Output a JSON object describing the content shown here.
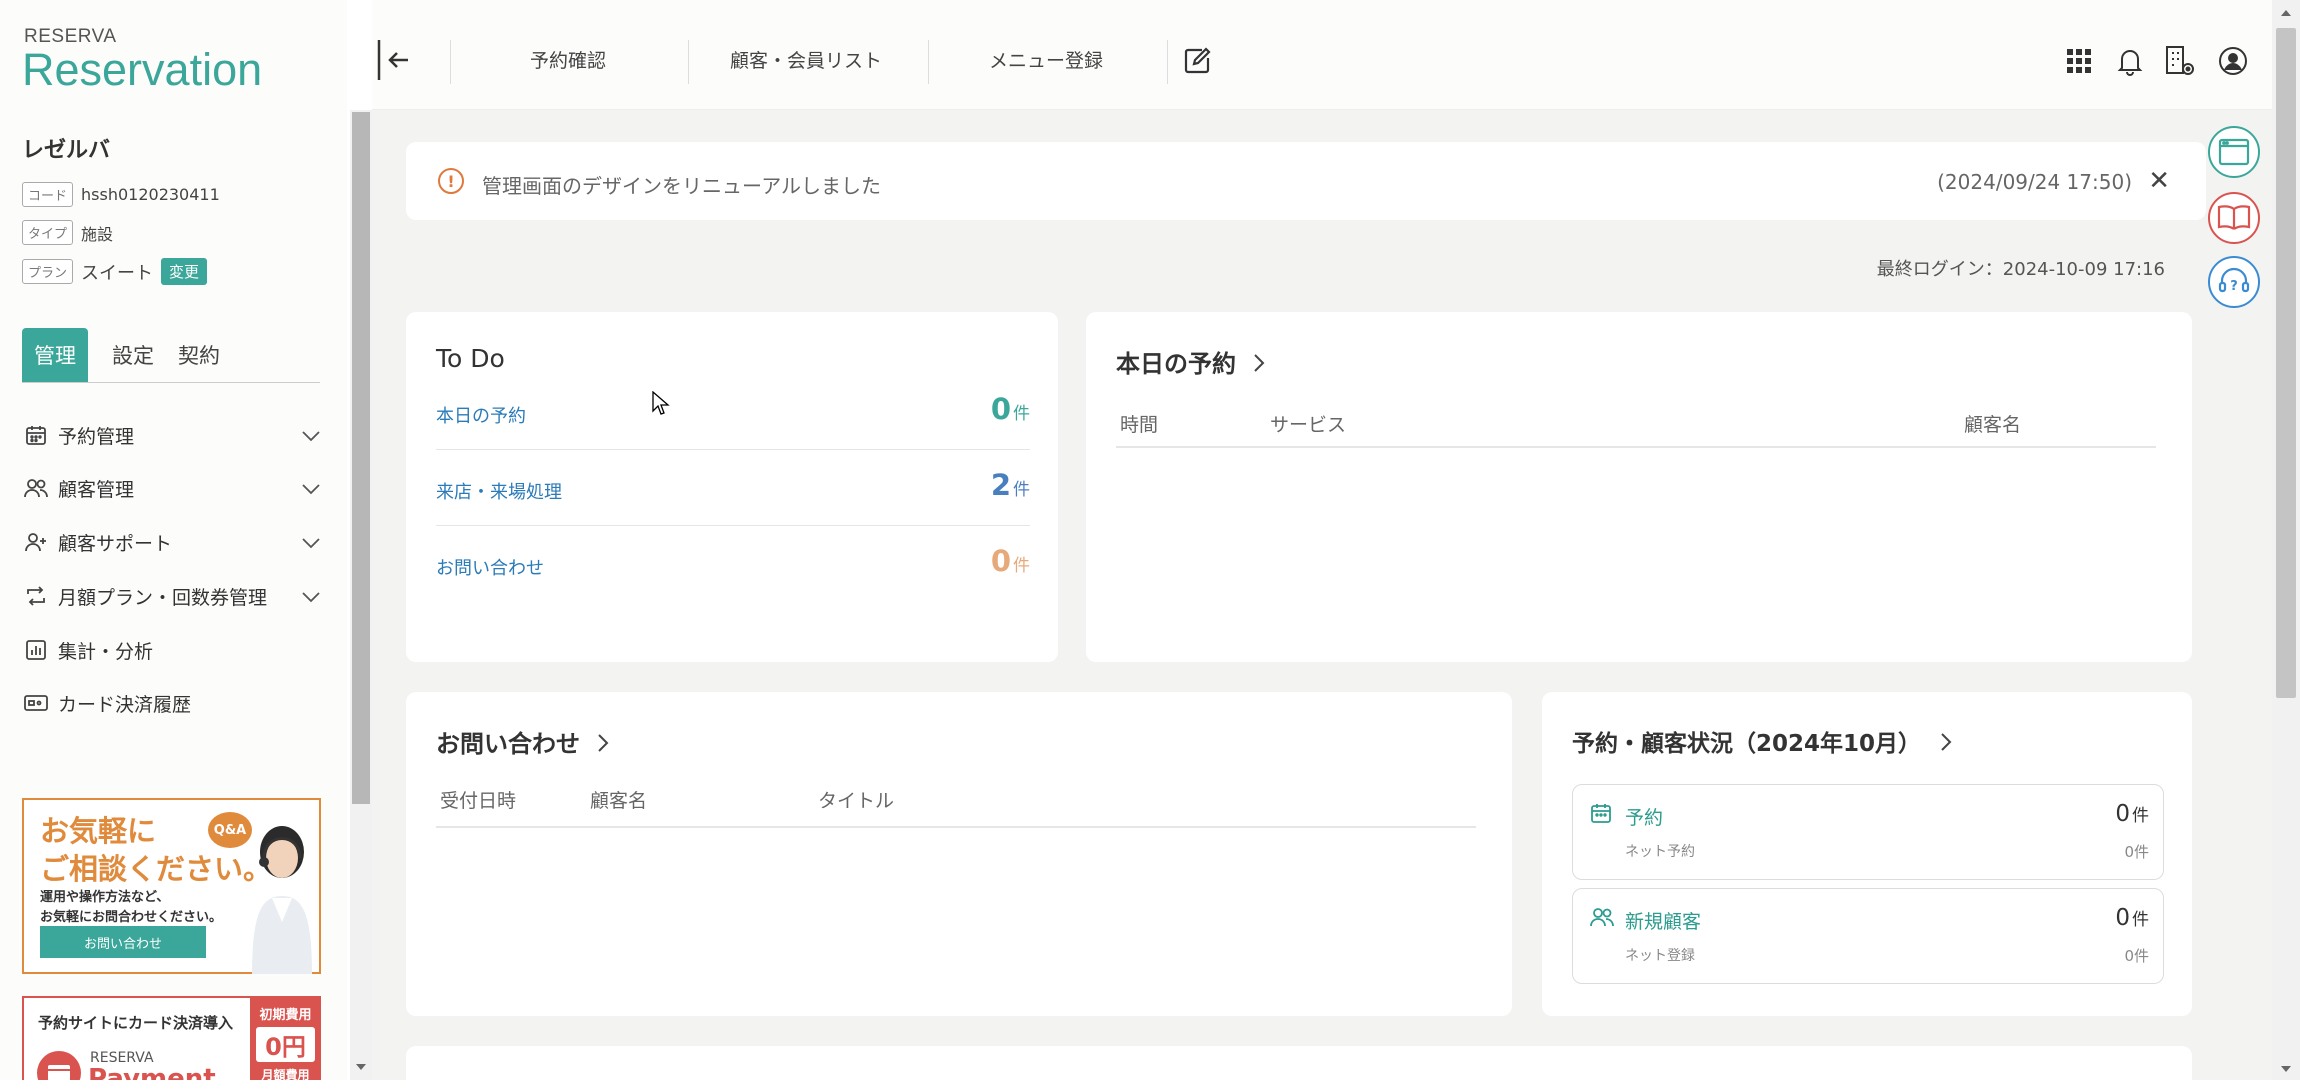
{
  "brand": {
    "top": "RESERVA",
    "main": "Reservation"
  },
  "shop": {
    "name": "レゼルバ",
    "code_tag": "コード",
    "code": "hssh0120230411",
    "type_tag": "タイプ",
    "type": "施設",
    "plan_tag": "プラン",
    "plan": "スイート",
    "change_label": "変更"
  },
  "side_tabs": [
    "管理",
    "設定",
    "契約"
  ],
  "side_nav": [
    {
      "label": "予約管理",
      "icon": "calendar-icon"
    },
    {
      "label": "顧客管理",
      "icon": "users-icon"
    },
    {
      "label": "顧客サポート",
      "icon": "user-plus-icon"
    },
    {
      "label": "月額プラン・回数券管理",
      "icon": "repeat-icon"
    },
    {
      "label": "集計・分析",
      "icon": "bar-chart-icon"
    },
    {
      "label": "カード決済履歴",
      "icon": "card-icon"
    }
  ],
  "promo1": {
    "line1": "お気軽に",
    "line2": "ご相談ください。",
    "qa": "Q&A",
    "desc1": "運用や操作方法など、",
    "desc2": "お気軽にお問合わせください。",
    "button": "お問い合わせ"
  },
  "promo2": {
    "title": "予約サイトにカード決済導入",
    "brand_top": "RESERVA",
    "brand_main": "Payment",
    "fee_label": "初期費用",
    "fee_value": "0円",
    "monthly_label": "月額費用"
  },
  "header": {
    "nav": [
      "予約確認",
      "顧客・会員リスト",
      "メニュー登録"
    ]
  },
  "notice": {
    "text": "管理画面のデザインをリニューアルしました",
    "date": "(2024/09/24 17:50)"
  },
  "last_login": "最終ログイン：2024-10-09 17:16",
  "todo": {
    "title": "To Do",
    "unit": "件",
    "items": [
      {
        "label": "本日の予約",
        "count": "0",
        "color": "#3ba79a"
      },
      {
        "label": "来店・来場処理",
        "count": "2",
        "color": "#4a7fbf"
      },
      {
        "label": "お問い合わせ",
        "count": "0",
        "color": "#e8a97a"
      }
    ]
  },
  "today_reservations": {
    "title": "本日の予約",
    "columns": [
      "時間",
      "サービス",
      "顧客名"
    ]
  },
  "inquiries": {
    "title": "お問い合わせ",
    "columns": [
      "受付日時",
      "顧客名",
      "タイトル"
    ]
  },
  "status": {
    "title": "予約・顧客状況（2024年10月）",
    "unit": "件",
    "boxes": [
      {
        "title": "予約",
        "sub": "ネット予約",
        "value": "0",
        "sub_value": "0件"
      },
      {
        "title": "新規顧客",
        "sub": "ネット登録",
        "value": "0",
        "sub_value": "0件"
      }
    ]
  },
  "colors": {
    "accent": "#3ba79a",
    "link": "#2b7bb9",
    "warning": "#e07a3c",
    "danger": "#d9534f"
  }
}
